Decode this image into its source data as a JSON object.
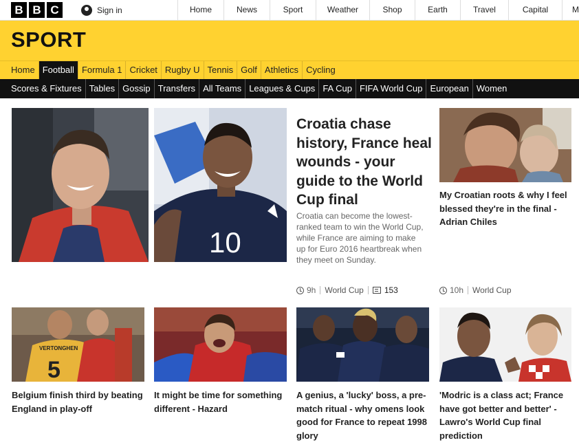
{
  "global": {
    "logo_letters": [
      "B",
      "B",
      "C"
    ],
    "signin_label": "Sign in",
    "nav": [
      "Home",
      "News",
      "Sport",
      "Weather",
      "Shop",
      "Earth",
      "Travel",
      "Capital",
      "M"
    ]
  },
  "section_title": "SPORT",
  "primary_nav": {
    "items": [
      "Home",
      "Football",
      "Formula 1",
      "Cricket",
      "Rugby U",
      "Tennis",
      "Golf",
      "Athletics",
      "Cycling"
    ],
    "active": "Football"
  },
  "secondary_nav": [
    "Scores & Fixtures",
    "Tables",
    "Gossip",
    "Transfers",
    "All Teams",
    "Leagues & Cups",
    "FA Cup",
    "FIFA World Cup",
    "European",
    "Women"
  ],
  "lead": {
    "headline": "Croatia chase history, France heal wounds - your guide to the World Cup final",
    "summary": "Croatia can become the lowest-ranked team to win the World Cup, while France are aiming to make up for Euro 2016 heartbreak when they meet on Sunday.",
    "time": "9h",
    "tag": "World Cup",
    "comments": "153"
  },
  "side": {
    "headline": "My Croatian roots & why I feel blessed they're in the final - Adrian Chiles",
    "time": "10h",
    "tag": "World Cup"
  },
  "row2": [
    {
      "headline": "Belgium finish third by beating England in play-off"
    },
    {
      "headline": "It might be time for something different - Hazard"
    },
    {
      "headline": "A genius, a 'lucky' boss, a pre-match ritual - why omens look good for France to repeat 1998 glory"
    },
    {
      "headline": "'Modric is a class act; France have got better and better' - Lawro's World Cup final prediction"
    }
  ],
  "image_text": {
    "shirt_number_lead": "10",
    "shirt_number_belgium": "5",
    "shirt_name_belgium": "VERTONGHEN"
  },
  "colors": {
    "sport_yellow": "#ffd230",
    "nav_black": "#111111"
  }
}
